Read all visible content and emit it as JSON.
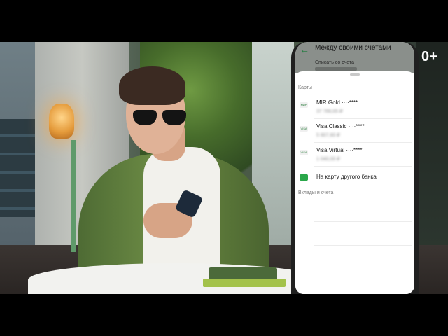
{
  "age_rating": "0+",
  "screen": {
    "title": "Между своими счетами",
    "from_label": "Списать со счета",
    "section_cards": "Карты",
    "cards": [
      {
        "icon": "МИР",
        "name": "MIR Gold ····****",
        "balance": "37 789,65 ₽"
      },
      {
        "icon": "VISA",
        "name": "Visa Classic ····****",
        "balance": "5 907,60 ₽"
      },
      {
        "icon": "VISA",
        "name": "Visa Virtual ····****",
        "balance": "1 040,00 ₽"
      }
    ],
    "other_bank_label": "На карту другого банка",
    "section_deposits": "Вклады и счета"
  },
  "colors": {
    "accent": "#1c7c3a",
    "green_icon": "#2aa74a"
  }
}
